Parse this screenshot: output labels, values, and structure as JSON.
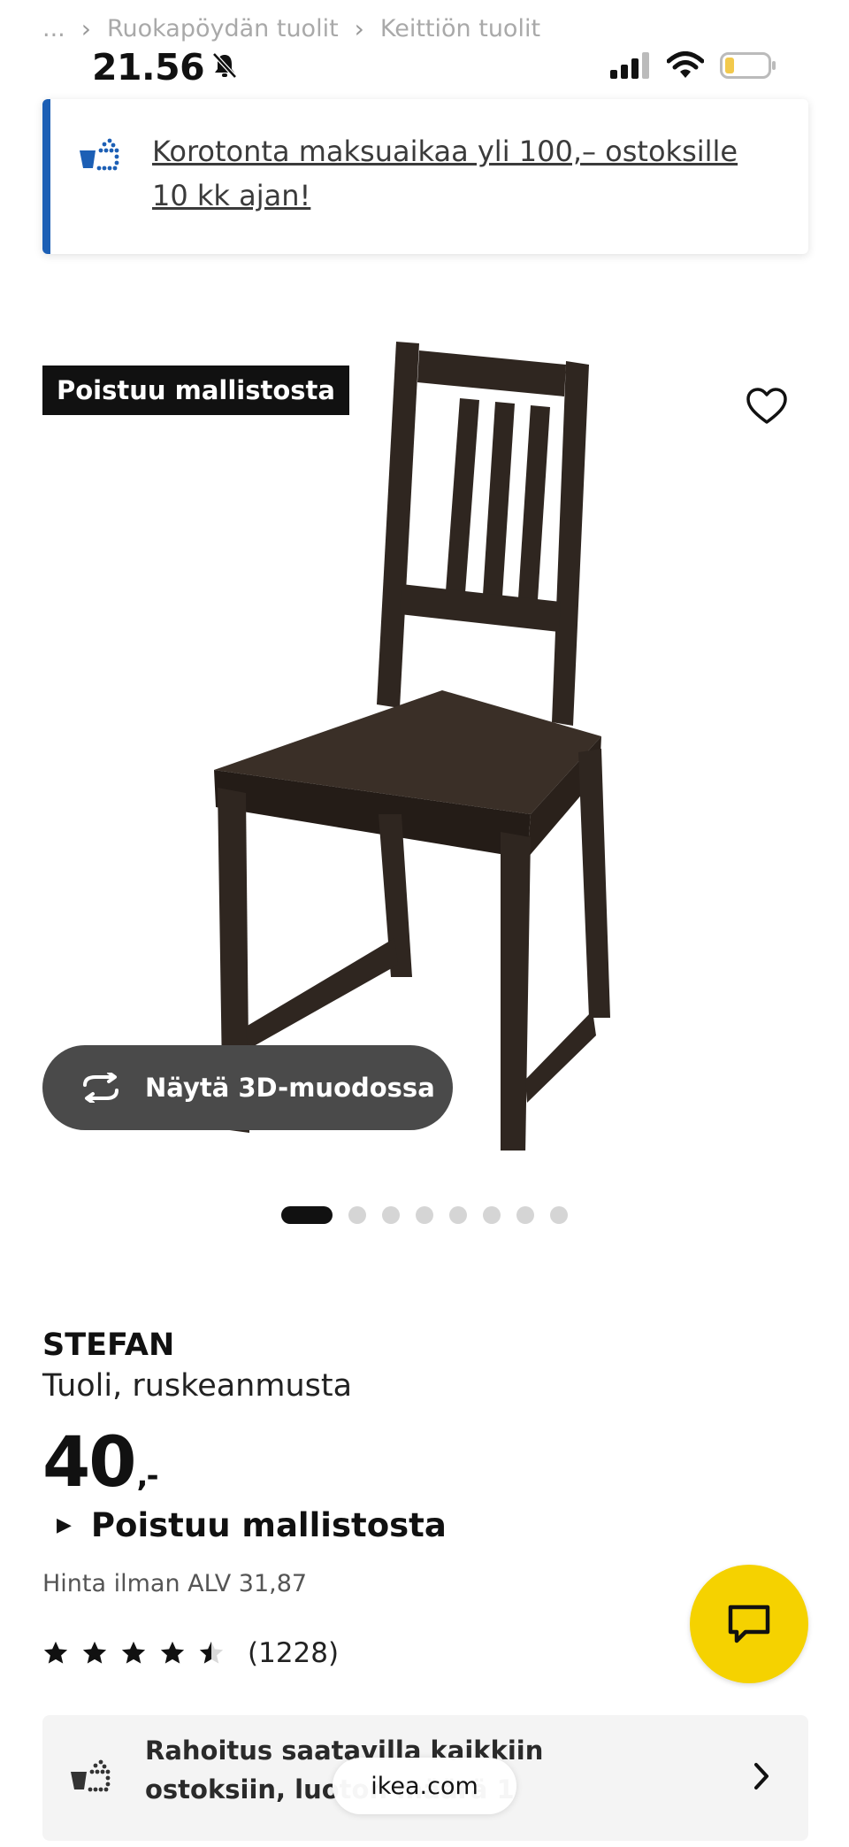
{
  "breadcrumb": {
    "ellipsis": "...",
    "items": [
      "Ruokapöydän tuolit",
      "Keittiön tuolit"
    ]
  },
  "status_bar": {
    "time": "21.56"
  },
  "banner": {
    "text": "Korotonta maksuaikaa yli 100,– ostoksille 10 kk ajan!",
    "accent": "#1c5fb5"
  },
  "image": {
    "badge": "Poistuu mallistosta",
    "view3d_label": "Näytä 3D-muodossa",
    "carousel": {
      "count": 8,
      "active": 1
    }
  },
  "product": {
    "name": "STEFAN",
    "description": "Tuoli, ruskeanmusta",
    "price": "40",
    "price_suffix": ",-",
    "discontinued": "Poistuu mallistosta",
    "vat_text": "Hinta ilman ALV 31,87",
    "rating": {
      "value": 4.5,
      "max": 5,
      "count_text": "(1228)"
    }
  },
  "financing": {
    "text": "Rahoitus saatavilla kaikkiin ostoksiin, luoton määrä 1"
  },
  "browser": {
    "url": "ikea.com"
  },
  "colors": {
    "chat_button": "#f5d200",
    "chair": "#2f2620"
  }
}
